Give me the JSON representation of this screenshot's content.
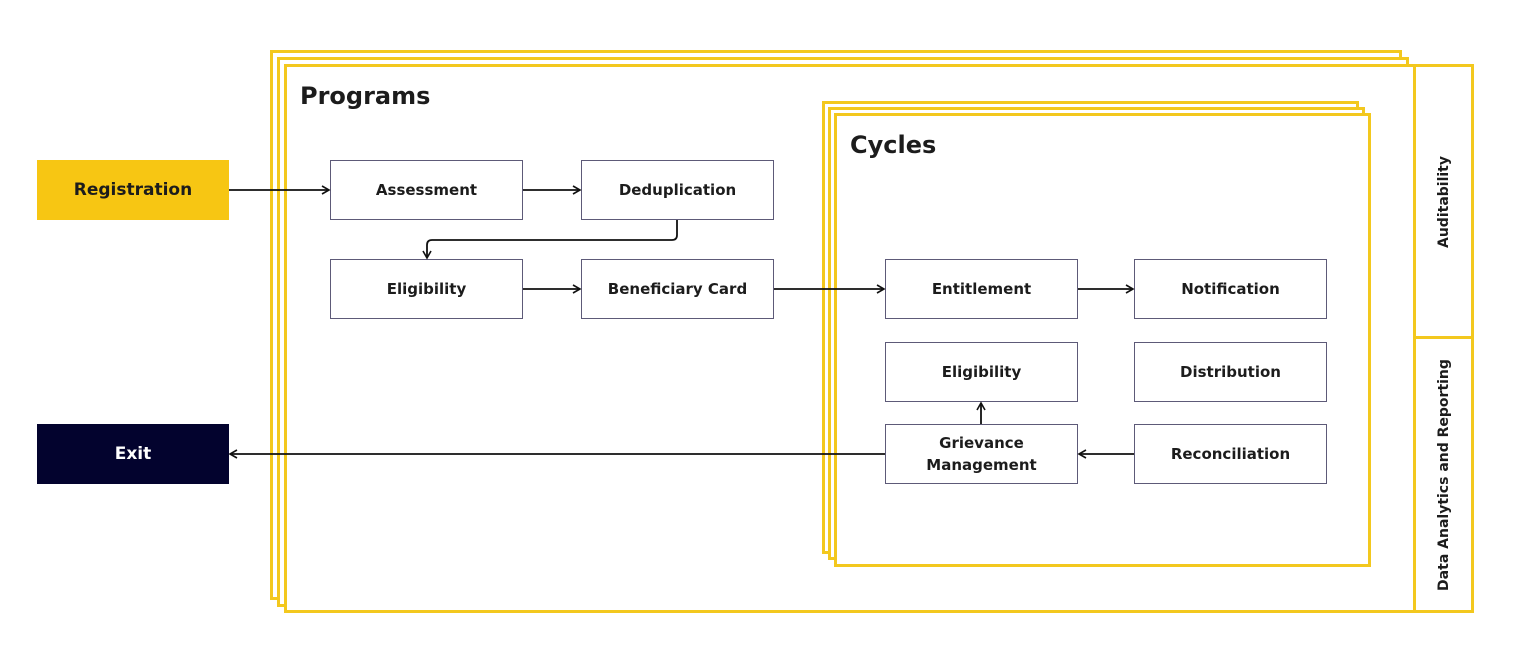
{
  "colors": {
    "frame_yellow": "#f3c81e",
    "registration_fill": "#f7c613",
    "exit_fill": "#03032e",
    "box_border": "#5d5a78",
    "arrow": "#111111"
  },
  "terminals": {
    "registration": "Registration",
    "exit": "Exit"
  },
  "programs": {
    "title": "Programs",
    "steps": {
      "assessment": "Assessment",
      "deduplication": "Deduplication",
      "eligibility": "Eligibility",
      "beneficiary_card": "Beneficiary Card"
    }
  },
  "cycles": {
    "title": "Cycles",
    "steps": {
      "entitlement": "Entitlement",
      "notification": "Notification",
      "eligibility": "Eligibility",
      "distribution": "Distribution",
      "grievance_line1": "Grievance",
      "grievance_line2": "Management",
      "reconciliation": "Reconciliation"
    }
  },
  "side_panels": {
    "auditability": "Auditability",
    "data_analytics": "Data Analytics  and Reporting"
  },
  "flows": [
    {
      "from": "Registration",
      "to": "Assessment"
    },
    {
      "from": "Assessment",
      "to": "Deduplication"
    },
    {
      "from": "Deduplication",
      "to": "Eligibility"
    },
    {
      "from": "Eligibility",
      "to": "Beneficiary Card"
    },
    {
      "from": "Beneficiary Card",
      "to": "Entitlement"
    },
    {
      "from": "Entitlement",
      "to": "Notification"
    },
    {
      "from": "Reconciliation",
      "to": "Grievance Management"
    },
    {
      "from": "Grievance Management",
      "to": "Eligibility (Cycles)"
    },
    {
      "from": "Grievance Management",
      "to": "Exit"
    }
  ]
}
